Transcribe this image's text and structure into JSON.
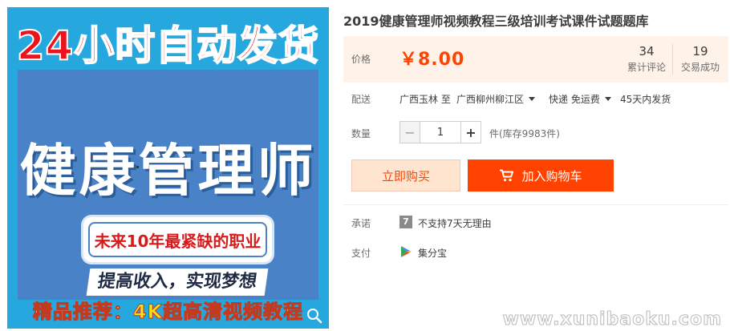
{
  "product_image": {
    "headline": "24小时自动发货",
    "main_title": "健康管理师",
    "tagline": "未来10年最紧缺的职业",
    "slogan": "提高收入，实现梦想",
    "footer": "精品推荐：4K超高清视频教程",
    "zoom_icon": "magnifier-icon"
  },
  "product": {
    "title": "2019健康管理师视频教程三级培训考试课件试题题库"
  },
  "price": {
    "label": "价格",
    "value": "￥8.00",
    "color": "#ff4400"
  },
  "stats": [
    {
      "count": "34",
      "label": "累计评论"
    },
    {
      "count": "19",
      "label": "交易成功"
    }
  ],
  "shipping": {
    "label": "配送",
    "origin": "广西玉林 至",
    "destination": "广西柳州柳江区",
    "method": "快递 免运费",
    "delivery": "45天内发货"
  },
  "quantity": {
    "label": "数量",
    "minus": "−",
    "value": "1",
    "plus": "+",
    "stock": "件(库存9983件)"
  },
  "actions": {
    "buy_now": "立即购买",
    "add_cart": "加入购物车",
    "cart_icon": "cart-icon",
    "accent": "#ff4200"
  },
  "promise": {
    "label": "承诺",
    "icon_glyph": "7",
    "text": "不支持7天无理由"
  },
  "payment": {
    "label": "支付",
    "icon": "play-store-icon",
    "text": "集分宝"
  },
  "watermark": "www.xunibaoku.com"
}
